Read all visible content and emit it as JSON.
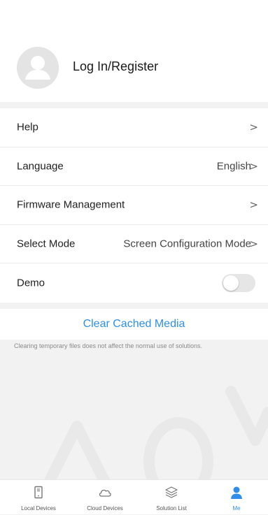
{
  "profile": {
    "login_label": "Log In/Register"
  },
  "settings": {
    "help": {
      "label": "Help"
    },
    "language": {
      "label": "Language",
      "value": "English"
    },
    "firmware": {
      "label": "Firmware Management"
    },
    "select_mode": {
      "label": "Select Mode",
      "value": "Screen Configuration Mode"
    },
    "demo": {
      "label": "Demo",
      "enabled": false
    }
  },
  "cache": {
    "clear_label": "Clear Cached Media",
    "note": "Clearing temporary files does not affect the normal use of solutions."
  },
  "tabbar": {
    "local": {
      "label": "Local Devices",
      "icon": "phone-device-icon"
    },
    "cloud": {
      "label": "Cloud Devices",
      "icon": "cloud-icon"
    },
    "solutions": {
      "label": "Solution List",
      "icon": "layers-icon"
    },
    "me": {
      "label": "Me",
      "icon": "person-icon",
      "active": true
    }
  },
  "colors": {
    "accent": "#2f8fe8",
    "background": "#f2f2f2",
    "card": "#ffffff"
  }
}
